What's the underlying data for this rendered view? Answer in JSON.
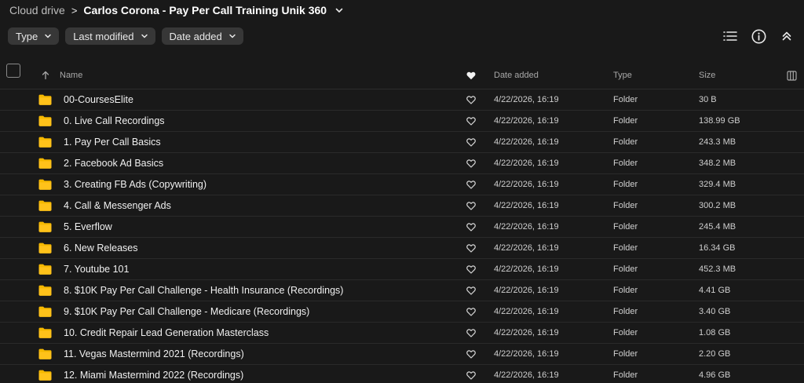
{
  "breadcrumb": {
    "root": "Cloud drive",
    "separator": ">",
    "current": "Carlos Corona - Pay Per Call Training Unik 360"
  },
  "filters": [
    {
      "label": "Type"
    },
    {
      "label": "Last modified"
    },
    {
      "label": "Date added"
    }
  ],
  "icons": {
    "list_view": "list-view-icon",
    "info": "info-icon",
    "collapse": "collapse-up-icon",
    "folder": "folder-icon",
    "favourite": "heart-icon",
    "columns": "columns-icon"
  },
  "columns": {
    "name": "Name",
    "date_added": "Date added",
    "type": "Type",
    "size": "Size"
  },
  "colors": {
    "background": "#191919",
    "chip": "#373737",
    "folder": "#f5b800"
  },
  "files": [
    {
      "name": "00-CoursesElite",
      "date": "4/22/2026, 16:19",
      "type": "Folder",
      "size": "30 B"
    },
    {
      "name": "0. Live Call Recordings",
      "date": "4/22/2026, 16:19",
      "type": "Folder",
      "size": "138.99 GB"
    },
    {
      "name": "1. Pay Per Call Basics",
      "date": "4/22/2026, 16:19",
      "type": "Folder",
      "size": "243.3 MB"
    },
    {
      "name": "2. Facebook Ad Basics",
      "date": "4/22/2026, 16:19",
      "type": "Folder",
      "size": "348.2 MB"
    },
    {
      "name": "3. Creating FB Ads (Copywriting)",
      "date": "4/22/2026, 16:19",
      "type": "Folder",
      "size": "329.4 MB"
    },
    {
      "name": "4. Call & Messenger Ads",
      "date": "4/22/2026, 16:19",
      "type": "Folder",
      "size": "300.2 MB"
    },
    {
      "name": "5. Everflow",
      "date": "4/22/2026, 16:19",
      "type": "Folder",
      "size": "245.4 MB"
    },
    {
      "name": "6. New Releases",
      "date": "4/22/2026, 16:19",
      "type": "Folder",
      "size": "16.34 GB"
    },
    {
      "name": "7. Youtube 101",
      "date": "4/22/2026, 16:19",
      "type": "Folder",
      "size": "452.3 MB"
    },
    {
      "name": "8. $10K Pay Per Call Challenge - Health Insurance (Recordings)",
      "date": "4/22/2026, 16:19",
      "type": "Folder",
      "size": "4.41 GB"
    },
    {
      "name": "9. $10K Pay Per Call Challenge - Medicare (Recordings)",
      "date": "4/22/2026, 16:19",
      "type": "Folder",
      "size": "3.40 GB"
    },
    {
      "name": "10. Credit Repair Lead Generation Masterclass",
      "date": "4/22/2026, 16:19",
      "type": "Folder",
      "size": "1.08 GB"
    },
    {
      "name": "11. Vegas Mastermind 2021 (Recordings)",
      "date": "4/22/2026, 16:19",
      "type": "Folder",
      "size": "2.20 GB"
    },
    {
      "name": "12. Miami Mastermind 2022 (Recordings)",
      "date": "4/22/2026, 16:19",
      "type": "Folder",
      "size": "4.96 GB"
    }
  ]
}
